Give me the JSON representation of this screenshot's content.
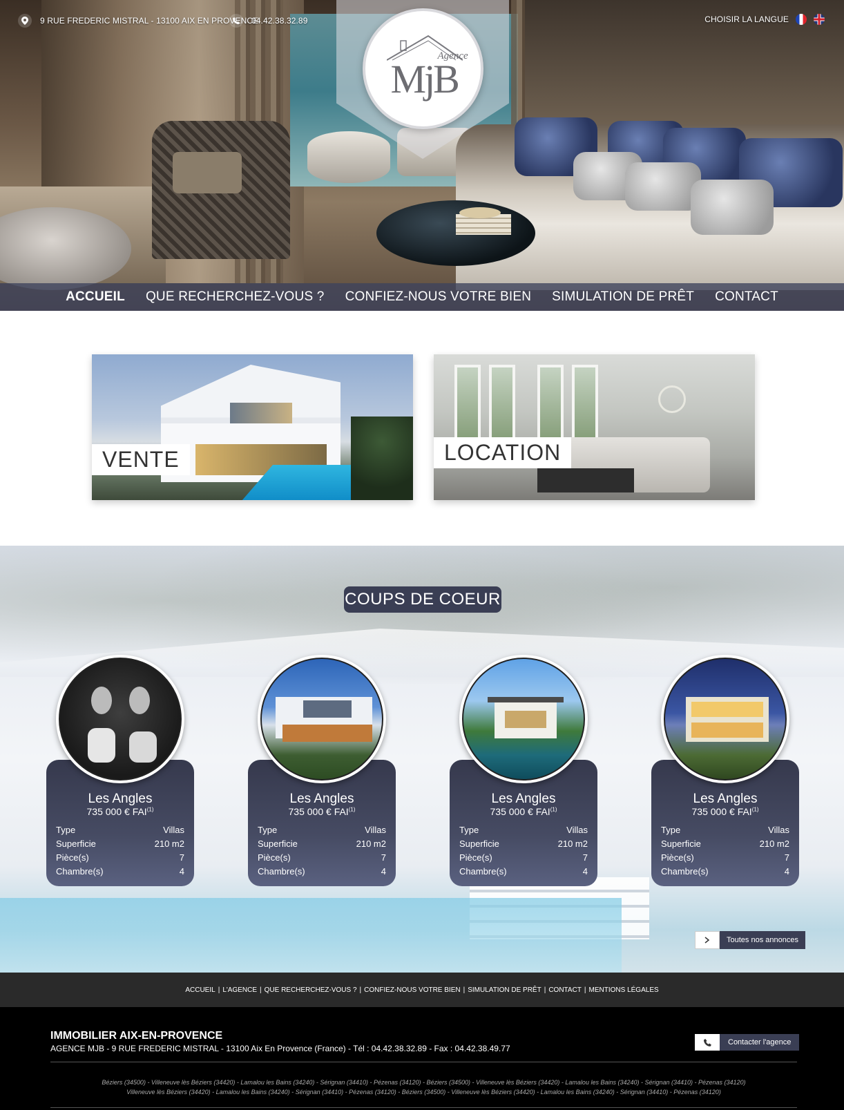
{
  "topbar": {
    "address": "9 RUE FREDERIC MISTRAL - 13100 AIX EN PROVENCE",
    "phone": "04.42.38.32.89",
    "language_label": "CHOISIR LA LANGUE",
    "address_icon": "location-pin-icon",
    "phone_icon": "phone-icon"
  },
  "logo": {
    "letters": "MjB",
    "tagline": "Agence"
  },
  "nav": {
    "items": [
      {
        "label": "ACCUEIL",
        "active": true
      },
      {
        "label": "QUE RECHERCHEZ-VOUS ?",
        "active": false
      },
      {
        "label": "CONFIEZ-NOUS VOTRE BIEN",
        "active": false
      },
      {
        "label": "SIMULATION DE PRÊT",
        "active": false
      },
      {
        "label": "CONTACT",
        "active": false
      }
    ]
  },
  "features": {
    "vente": "VENTE",
    "location": "LOCATION"
  },
  "coups_de_coeur": {
    "title": "COUPS DE COEUR",
    "row_labels": {
      "type": "Type",
      "surface": "Superficie",
      "rooms": "Pièce(s)",
      "bedrooms": "Chambre(s)"
    },
    "cards": [
      {
        "city": "Les Angles",
        "price": "735 000 € FAI",
        "price_note": "(1)",
        "type": "Villas",
        "surface": "210 m2",
        "rooms": "7",
        "bedrooms": "4"
      },
      {
        "city": "Les Angles",
        "price": "735 000 € FAI",
        "price_note": "(1)",
        "type": "Villas",
        "surface": "210 m2",
        "rooms": "7",
        "bedrooms": "4"
      },
      {
        "city": "Les Angles",
        "price": "735 000 € FAI",
        "price_note": "(1)",
        "type": "Villas",
        "surface": "210 m2",
        "rooms": "7",
        "bedrooms": "4"
      },
      {
        "city": "Les Angles",
        "price": "735 000 € FAI",
        "price_note": "(1)",
        "type": "Villas",
        "surface": "210 m2",
        "rooms": "7",
        "bedrooms": "4"
      }
    ],
    "all_ads": "Toutes nos annonces"
  },
  "footer_nav": {
    "items": [
      "ACCUEIL",
      "L'AGENCE",
      "QUE RECHERCHEZ-VOUS ?",
      "CONFIEZ-NOUS VOTRE BIEN",
      "SIMULATION DE PRÊT",
      "CONTACT",
      "MENTIONS LÉGALES"
    ]
  },
  "footer": {
    "title": "IMMOBILIER AIX-EN-PROVENCE",
    "address": "AGENCE MJB - 9 RUE FREDERIC MISTRAL - 13100 Aix En Provence (France) - Tél : 04.42.38.32.89 - Fax : 04.42.38.49.77",
    "contact_label": "Contacter l'agence",
    "cities_line1": "Béziers (34500) - Villeneuve lès Béziers (34420) - Lamalou les Bains (34240) - Sérignan (34410) - Pézenas (34120) - Béziers (34500) - Villeneuve lès Béziers (34420) - Lamalou les Bains (34240) - Sérignan (34410) - Pézenas (34120)",
    "cities_line2": "Villeneuve lès Béziers (34420) - Lamalou les Bains (34240) - Sérignan (34410) - Pézenas (34120) - Béziers (34500) - Villeneuve lès Béziers (34420) - Lamalou les Bains (34240) - Sérignan (34410) - Pézenas (34120)"
  },
  "colors": {
    "nav_bg": "#3e425c",
    "accent_dark": "#3a3e54",
    "footer_bg": "#000000"
  }
}
